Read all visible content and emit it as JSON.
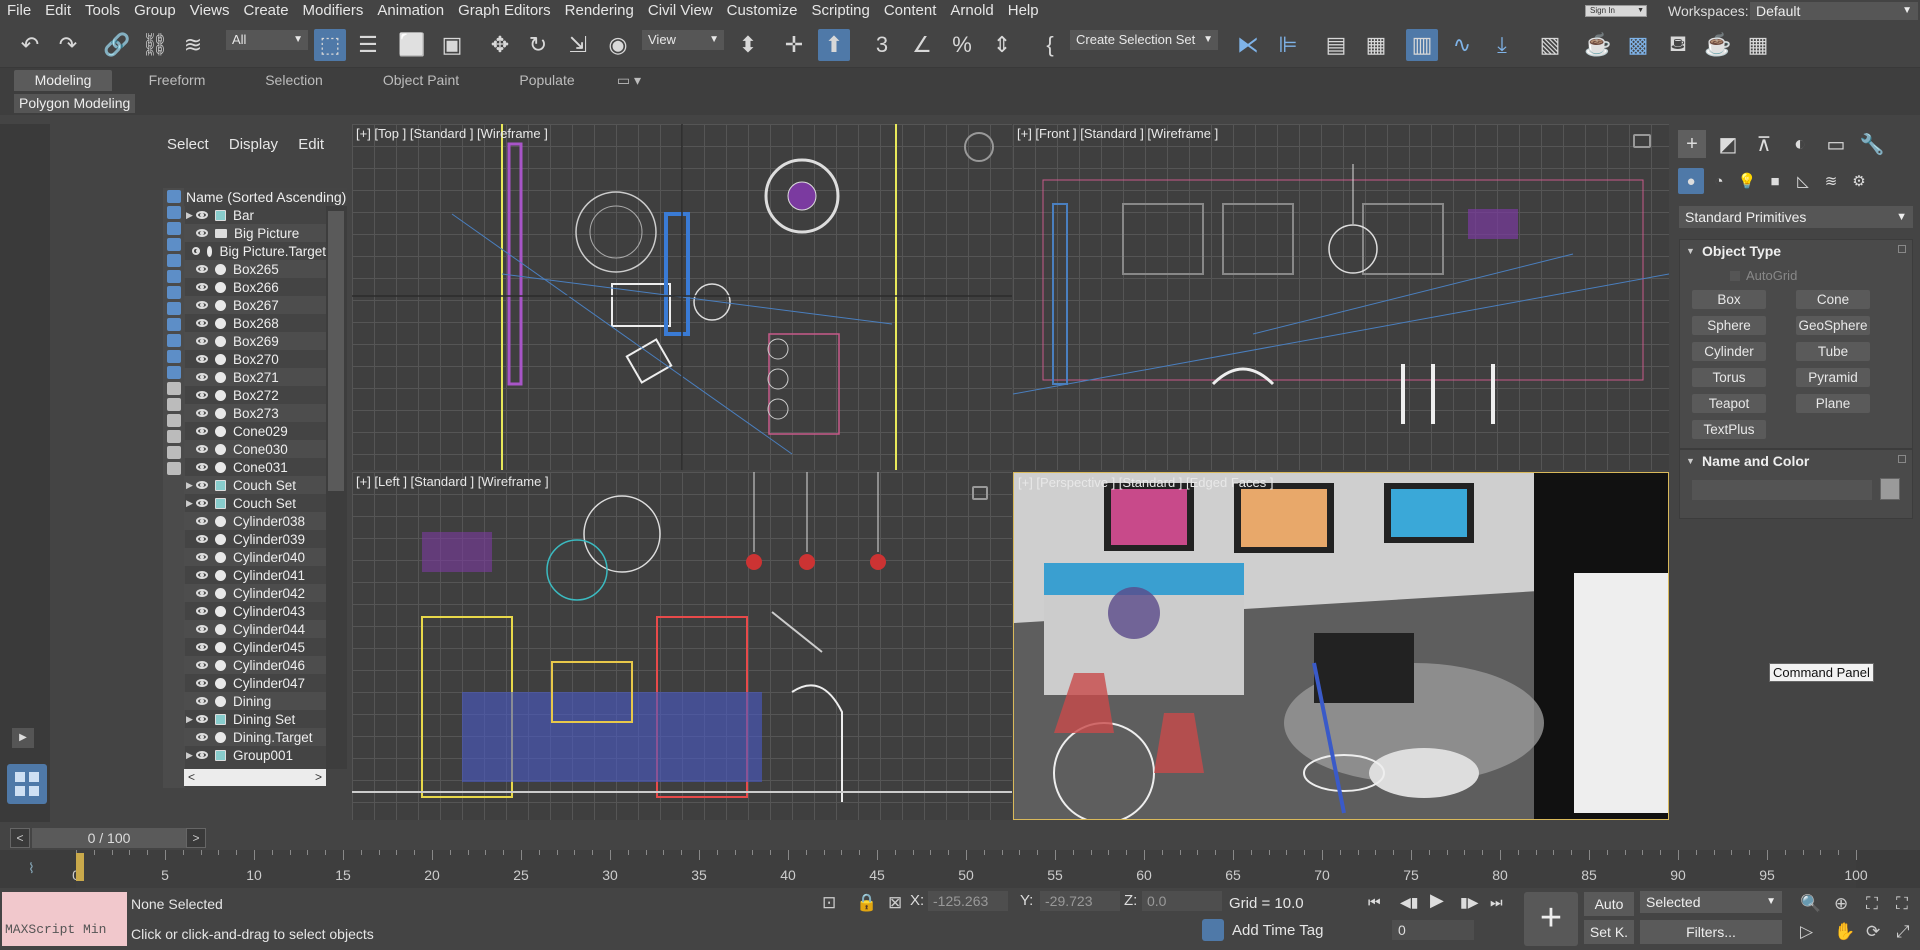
{
  "menu": [
    "File",
    "Edit",
    "Tools",
    "Group",
    "Views",
    "Create",
    "Modifiers",
    "Animation",
    "Graph Editors",
    "Rendering",
    "Civil View",
    "Customize",
    "Scripting",
    "Content",
    "Arnold",
    "Help"
  ],
  "signin": "Sign In",
  "workspace": {
    "label": "Workspaces:",
    "value": "Default"
  },
  "toolbar": {
    "filter": "All",
    "refcoord": "View",
    "selection_set": "Create Selection Set"
  },
  "ribbon": {
    "tabs": [
      "Modeling",
      "Freeform",
      "Selection",
      "Object Paint",
      "Populate"
    ],
    "subpanel": "Polygon Modeling"
  },
  "scene_explorer": {
    "menu": [
      "Select",
      "Display",
      "Edit"
    ],
    "column": "Name (Sorted Ascending)",
    "rows": [
      {
        "name": "Bar",
        "type": "group"
      },
      {
        "name": "Big Picture",
        "type": "camera"
      },
      {
        "name": "Big Picture.Target",
        "type": "target"
      },
      {
        "name": "Box265",
        "type": "obj"
      },
      {
        "name": "Box266",
        "type": "obj"
      },
      {
        "name": "Box267",
        "type": "obj"
      },
      {
        "name": "Box268",
        "type": "obj"
      },
      {
        "name": "Box269",
        "type": "obj"
      },
      {
        "name": "Box270",
        "type": "obj"
      },
      {
        "name": "Box271",
        "type": "obj"
      },
      {
        "name": "Box272",
        "type": "obj"
      },
      {
        "name": "Box273",
        "type": "obj"
      },
      {
        "name": "Cone029",
        "type": "obj"
      },
      {
        "name": "Cone030",
        "type": "obj"
      },
      {
        "name": "Cone031",
        "type": "obj"
      },
      {
        "name": "Couch Set",
        "type": "group"
      },
      {
        "name": "Couch Set",
        "type": "group"
      },
      {
        "name": "Cylinder038",
        "type": "obj"
      },
      {
        "name": "Cylinder039",
        "type": "obj"
      },
      {
        "name": "Cylinder040",
        "type": "obj"
      },
      {
        "name": "Cylinder041",
        "type": "obj"
      },
      {
        "name": "Cylinder042",
        "type": "obj"
      },
      {
        "name": "Cylinder043",
        "type": "obj"
      },
      {
        "name": "Cylinder044",
        "type": "obj"
      },
      {
        "name": "Cylinder045",
        "type": "obj"
      },
      {
        "name": "Cylinder046",
        "type": "obj"
      },
      {
        "name": "Cylinder047",
        "type": "obj"
      },
      {
        "name": "Dining",
        "type": "obj"
      },
      {
        "name": "Dining Set",
        "type": "group"
      },
      {
        "name": "Dining.Target",
        "type": "target"
      },
      {
        "name": "Group001",
        "type": "group"
      }
    ]
  },
  "viewports": {
    "top": "[+] [Top ] [Standard ] [Wireframe ]",
    "front": "[+] [Front ] [Standard ] [Wireframe ]",
    "left": "[+] [Left ] [Standard ] [Wireframe ]",
    "persp": "[+] [Perspective ] [Standard ] [Edged Faces ]"
  },
  "command_panel": {
    "dropdown": "Standard Primitives",
    "object_type": {
      "title": "Object Type",
      "autogrid": "AutoGrid",
      "buttons": [
        "Box",
        "Cone",
        "Sphere",
        "GeoSphere",
        "Cylinder",
        "Tube",
        "Torus",
        "Pyramid",
        "Teapot",
        "Plane",
        "TextPlus"
      ]
    },
    "name_color": {
      "title": "Name and Color"
    },
    "tooltip": "Command Panel"
  },
  "timeline": {
    "frame": "0 / 100",
    "ticks": [
      "0",
      "5",
      "10",
      "15",
      "20",
      "25",
      "30",
      "35",
      "40",
      "45",
      "50",
      "55",
      "60",
      "65",
      "70",
      "75",
      "80",
      "85",
      "90",
      "95",
      "100"
    ]
  },
  "status": {
    "maxscript": "MAXScript Min",
    "selected": "None Selected",
    "prompt": "Click or click-and-drag to select objects",
    "x_label": "X:",
    "x": "-125.263",
    "y_label": "Y:",
    "y": "-29.723",
    "z_label": "Z:",
    "z": "0.0",
    "grid": "Grid = 10.0",
    "add_time_tag": "Add Time Tag",
    "auto": "Auto",
    "setk": "Set K.",
    "key_filter": "Selected",
    "filters": "Filters...",
    "frame_spin": "0"
  },
  "colors": {
    "accent": "#4f79a8",
    "viewport_border": "#d9b95b",
    "maxscript_bg": "#f1c8cc"
  }
}
